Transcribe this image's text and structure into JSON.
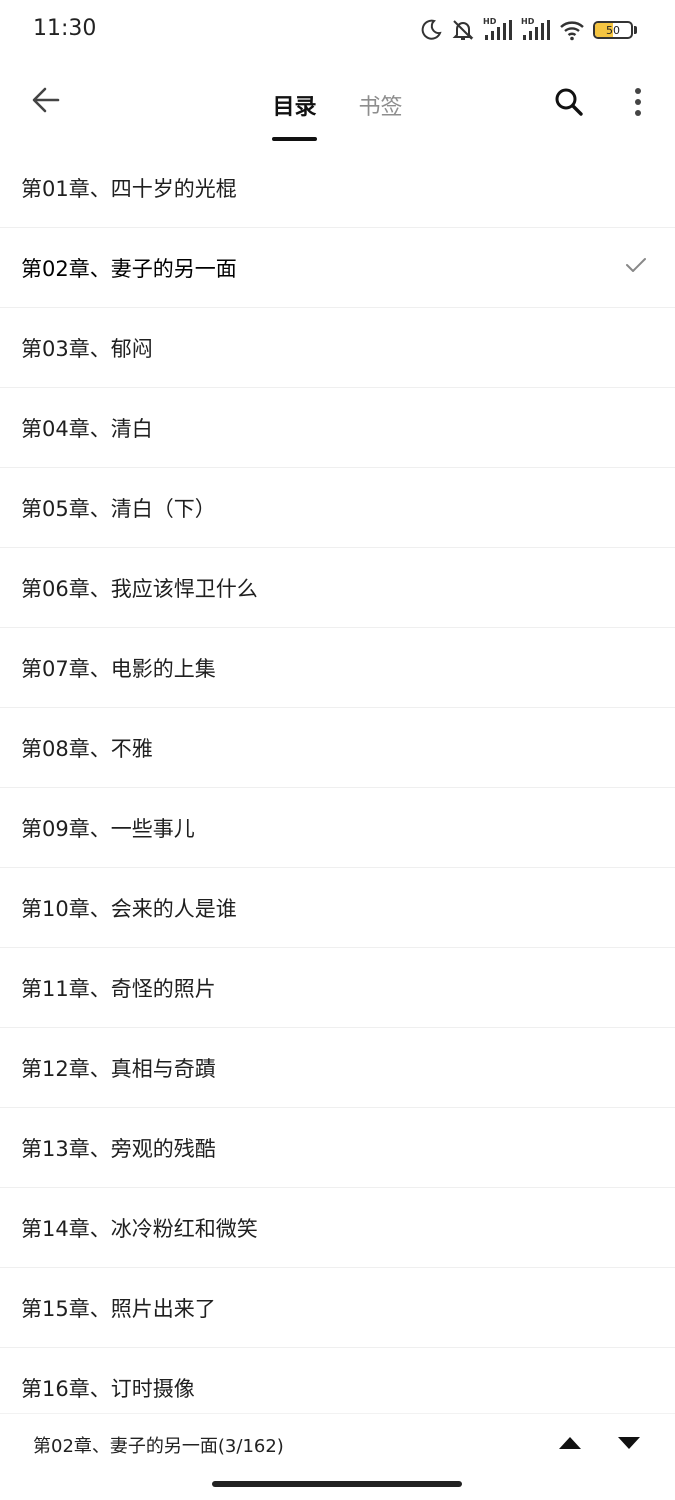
{
  "status_bar": {
    "time": "11:30",
    "icons": [
      "moon-icon",
      "bell-off-icon",
      "hd-signal-icon",
      "hd-signal-icon",
      "wifi-icon",
      "battery-icon"
    ],
    "hd_label": "HD",
    "battery_level": "50",
    "battery_color": "#f5c542"
  },
  "header": {
    "back_icon": "arrow-left-icon",
    "tabs": [
      {
        "label": "目录",
        "active": true
      },
      {
        "label": "书签",
        "active": false
      }
    ],
    "search_icon": "search-icon",
    "more_icon": "more-vertical-icon"
  },
  "chapters": [
    {
      "title": "第01章、四十岁的光棍",
      "current": false
    },
    {
      "title": "第02章、妻子的另一面",
      "current": true
    },
    {
      "title": "第03章、郁闷",
      "current": false
    },
    {
      "title": "第04章、清白",
      "current": false
    },
    {
      "title": "第05章、清白（下）",
      "current": false
    },
    {
      "title": "第06章、我应该悍卫什么",
      "current": false
    },
    {
      "title": "第07章、电影的上集",
      "current": false
    },
    {
      "title": "第08章、不雅",
      "current": false
    },
    {
      "title": "第09章、一些事儿",
      "current": false
    },
    {
      "title": "第10章、会来的人是谁",
      "current": false
    },
    {
      "title": "第11章、奇怪的照片",
      "current": false
    },
    {
      "title": "第12章、真相与奇蹟",
      "current": false
    },
    {
      "title": "第13章、旁观的残酷",
      "current": false
    },
    {
      "title": "第14章、冰冷粉红和微笑",
      "current": false
    },
    {
      "title": "第15章、照片出来了",
      "current": false
    },
    {
      "title": "第16章、订时摄像",
      "current": false
    }
  ],
  "bottom_bar": {
    "progress": "第02章、妻子的另一面(3/162)",
    "up_icon": "triangle-up-icon",
    "down_icon": "triangle-down-icon"
  }
}
